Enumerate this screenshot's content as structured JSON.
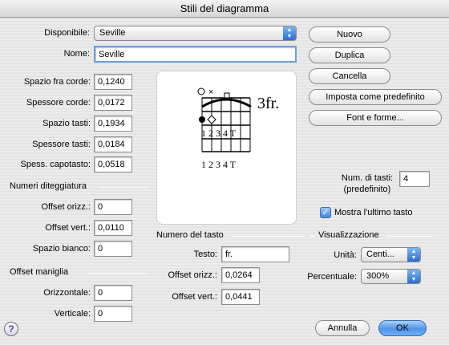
{
  "window": {
    "title": "Stili del diagramma"
  },
  "top": {
    "disponibile_label": "Disponibile:",
    "disponibile_value": "Seville",
    "nome_label": "Nome:",
    "nome_value": "Seville"
  },
  "buttons": {
    "nuovo": "Nuovo",
    "duplica": "Duplica",
    "cancella": "Cancella",
    "imposta": "Imposta come predefinito",
    "font": "Font e forme...",
    "annulla": "Annulla",
    "ok": "OK",
    "help": "?"
  },
  "spacing": {
    "spazio_corde_label": "Spazio fra corde:",
    "spazio_corde_value": "0,1240",
    "spessore_corde_label": "Spessore corde:",
    "spessore_corde_value": "0,0172",
    "spazio_tasti_label": "Spazio tasti:",
    "spazio_tasti_value": "0,1934",
    "spessore_tasti_label": "Spessore tasti:",
    "spessore_tasti_value": "0,0184",
    "capotasto_label": "Spess. capotasto:",
    "capotasto_value": "0,0518"
  },
  "diteggiatura": {
    "title": "Numeri diteggiatura",
    "offset_orizz_label": "Offset orizz.:",
    "offset_orizz_value": "0",
    "offset_vert_label": "Offset vert.:",
    "offset_vert_value": "0,0110",
    "spazio_bianco_label": "Spazio bianco:",
    "spazio_bianco_value": "0"
  },
  "maniglia": {
    "title": "Offset maniglia",
    "orizzontale_label": "Orizzontale:",
    "orizzontale_value": "0",
    "verticale_label": "Verticale:",
    "verticale_value": "0"
  },
  "preview": {
    "fret_label": "3fr.",
    "finger_row_1": "1 2 3 4 T",
    "finger_row_2": "1 2 3 4 T"
  },
  "tasti": {
    "num_label_1": "Num. di tasti:",
    "num_label_2": "(predefinito)",
    "num_value": "4",
    "mostra_label": "Mostra l'ultimo tasto",
    "mostra_checked": true
  },
  "numero_tasto": {
    "title": "Numero del tasto",
    "testo_label": "Testo:",
    "testo_value": "fr.",
    "offset_orizz_label": "Offset orizz.:",
    "offset_orizz_value": "0,0264",
    "offset_vert_label": "Offset vert.:",
    "offset_vert_value": "0,0441"
  },
  "visualizzazione": {
    "title": "Visualizzazione",
    "unita_label": "Unità:",
    "unita_value": "Centi...",
    "percentuale_label": "Percentuale:",
    "percentuale_value": "300%"
  }
}
